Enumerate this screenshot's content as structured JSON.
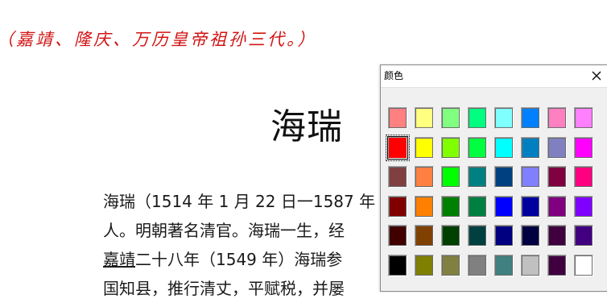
{
  "document": {
    "red_line": "（嘉靖、隆庆、万历皇帝祖孙三代。）",
    "title": "海瑞",
    "paragraph_lines": [
      {
        "before": "",
        "link": "",
        "after": "海瑞（1514 年 1 月 22 日一1587 年"
      },
      {
        "before": "",
        "link": "",
        "after": "人。明朝著名清官。海瑞一生，经"
      },
      {
        "before": "",
        "link": "嘉靖",
        "after": "二十八年（1549 年）海瑞参"
      },
      {
        "before": "",
        "link": "",
        "after": "国知县，推行清丈，平赋税，并屡"
      }
    ]
  },
  "color_dialog": {
    "title": "颜色",
    "close_icon": "close-icon",
    "selected_index": 8,
    "colors": [
      "#ff8080",
      "#ffff80",
      "#80ff80",
      "#00ff80",
      "#80ffff",
      "#0080ff",
      "#ff80c0",
      "#ff80ff",
      "#ff0000",
      "#ffff00",
      "#80ff00",
      "#00ff40",
      "#00ffff",
      "#0080c0",
      "#8080c0",
      "#ff00ff",
      "#804040",
      "#ff8040",
      "#00ff00",
      "#008080",
      "#004080",
      "#8080ff",
      "#800040",
      "#ff0080",
      "#800000",
      "#ff8000",
      "#008000",
      "#008040",
      "#0000ff",
      "#0000a0",
      "#800080",
      "#8000ff",
      "#400000",
      "#804000",
      "#004000",
      "#004040",
      "#000080",
      "#000040",
      "#400040",
      "#400080",
      "#000000",
      "#808000",
      "#808040",
      "#808080",
      "#408080",
      "#c0c0c0",
      "#400040",
      "#ffffff"
    ]
  }
}
